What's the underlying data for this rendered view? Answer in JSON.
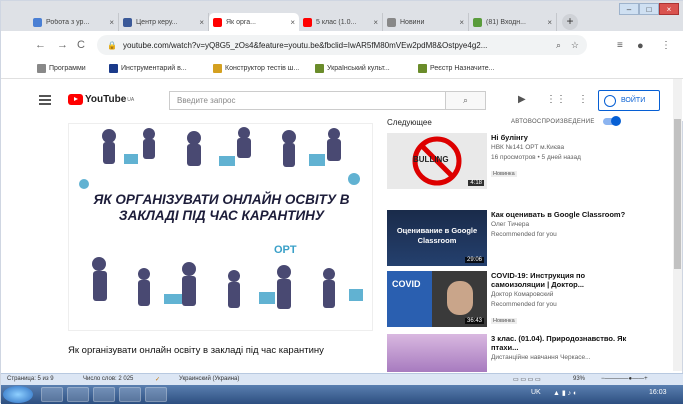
{
  "browser": {
    "tabs": [
      {
        "title": "Робота з ур...",
        "favicon_color": "#4a7fd4",
        "active": false
      },
      {
        "title": "Центр керу...",
        "favicon_color": "#3b5998",
        "active": false
      },
      {
        "title": "Як орга...",
        "favicon_color": "#ff0000",
        "active": true
      },
      {
        "title": "5 клас (1.0...",
        "favicon_color": "#ff0000",
        "active": false
      },
      {
        "title": "Новини",
        "favicon_color": "#888888",
        "active": false
      },
      {
        "title": "(81) Входн...",
        "favicon_color": "#5a9c3c",
        "active": false
      }
    ],
    "close_glyph": "×",
    "new_tab": "+",
    "url": "youtube.com/watch?v=yQ8G5_zOs4&feature=youtu.be&fbclid=IwAR5fM80mVEw2pdM8&Ostpye4g2...",
    "bookmarks": [
      {
        "label": "Программи",
        "color": "#888888"
      },
      {
        "label": "Инструментарий в...",
        "color": "#1a3a8a"
      },
      {
        "label": "Конструктор тестів ш...",
        "color": "#d4a020"
      },
      {
        "label": "Український культ...",
        "color": "#6a8c2a"
      },
      {
        "label": "Реєстр Назначите...",
        "color": "#6a8c2a"
      }
    ]
  },
  "youtube": {
    "logo": "YouTube",
    "logo_region": "UA",
    "search_placeholder": "Введите запрос",
    "signin_label": "ВОЙТИ",
    "video": {
      "image_title": "ЯК ОРГАНІЗУВАТИ ОНЛАЙН ОСВІТУ В ЗАКЛАДІ ПІД ЧАС КАРАНТИНУ",
      "image_brand": "OPT",
      "title": "Як організувати онлайн освіту в закладі під час карантину"
    },
    "sidebar": {
      "next_label": "Следующее",
      "autoplay_label": "АВТОВОСПРОИЗВЕДЕНИЕ",
      "cards": [
        {
          "title": "Ні булінгу",
          "channel": "НВК №141 ОРТ м.Києва",
          "info": "16 просмотров • 5 дней назад",
          "badge": "Новинка",
          "duration": "4:18",
          "thumb_text": "BULLING"
        },
        {
          "title": "Как оценивать в Google Classroom?",
          "channel": "Олег Тичера",
          "info": "Recommended for you",
          "badge": "",
          "duration": "29:06",
          "thumb_text": "Оценивание в Google Classroom"
        },
        {
          "title": "COVID-19: Инструкция по самоизоляции | Доктор...",
          "channel": "Доктор Комаровский",
          "info": "Recommended for you",
          "badge": "Новинка",
          "duration": "36:43",
          "thumb_text": "COVID"
        },
        {
          "title": "3 клас. (01.04). Природознавство. Як птахи...",
          "channel": "Дистанційне навчання Черкасе...",
          "info": "",
          "badge": "",
          "duration": "",
          "thumb_text": ""
        }
      ]
    }
  },
  "word_status": {
    "page": "Страница: 5 из 9",
    "words": "Число слов: 2 025",
    "language": "Украинский (Украина)",
    "zoom": "93%"
  },
  "taskbar": {
    "lang": "UK",
    "time": "16:03"
  }
}
